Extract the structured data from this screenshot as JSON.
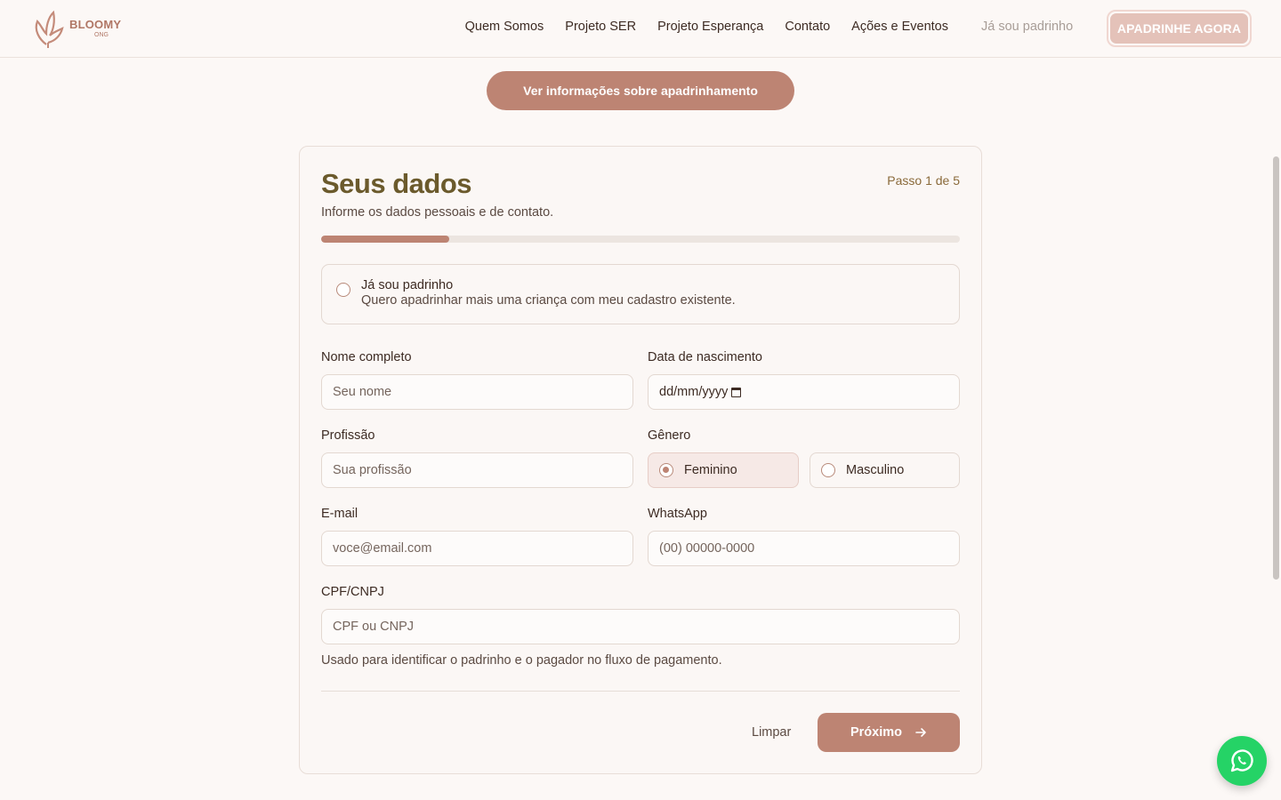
{
  "brand": {
    "name": "BLOOMY",
    "sub": "ONG",
    "accent": "#bd8473",
    "title_color": "#6b5a2c"
  },
  "nav": {
    "items": [
      "Quem Somos",
      "Projeto SER",
      "Projeto Esperança",
      "Contato",
      "Ações e Eventos"
    ],
    "existing_link": "Já sou padrinho",
    "cta": "APADRINHE AGORA"
  },
  "info_button": "Ver informações sobre apadrinhamento",
  "form": {
    "title": "Seus dados",
    "subtitle": "Informe os dados pessoais e de contato.",
    "step": "Passo 1 de 5",
    "progress_fraction": 0.2,
    "existing": {
      "title": "Já sou padrinho",
      "description": "Quero apadrinhar mais uma criança com meu cadastro existente."
    },
    "fields": {
      "name": {
        "label": "Nome completo",
        "placeholder": "Seu nome"
      },
      "birth": {
        "label": "Data de nascimento",
        "value": "dd/mm/yyyy"
      },
      "profession": {
        "label": "Profissão",
        "placeholder": "Sua profissão"
      },
      "gender": {
        "label": "Gênero",
        "options": [
          "Feminino",
          "Masculino"
        ],
        "selected": "Feminino"
      },
      "email": {
        "label": "E-mail",
        "placeholder": "voce@email.com"
      },
      "whatsapp": {
        "label": "WhatsApp",
        "placeholder": "(00) 00000-0000"
      },
      "cpf": {
        "label": "CPF/CNPJ",
        "placeholder": "CPF ou CNPJ"
      }
    },
    "helper": "Usado para identificar o padrinho e o pagador no fluxo de pagamento.",
    "clear_label": "Limpar",
    "next_label": "Próximo"
  },
  "icons": {
    "whatsapp": "whatsapp-icon",
    "next": "arrow-right-icon",
    "calendar": "calendar-icon"
  }
}
